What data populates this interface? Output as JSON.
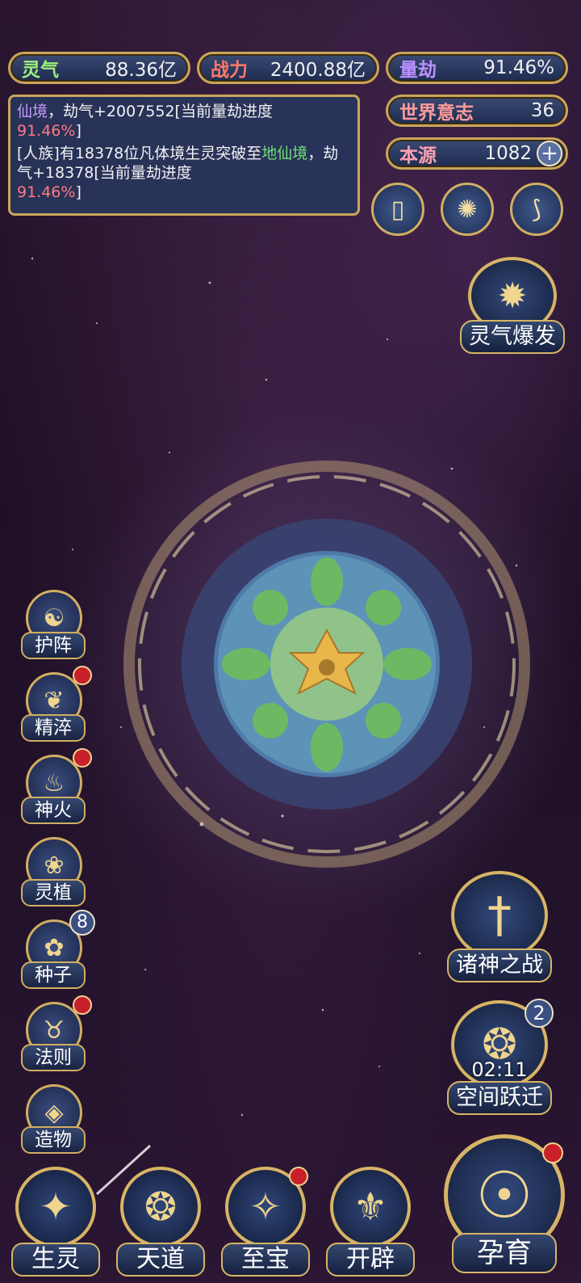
{
  "stats": {
    "lingqi_label": "灵气",
    "lingqi_value": "88.36亿",
    "zhanli_label": "战力",
    "zhanli_value": "2400.88亿",
    "liangjie_label": "量劫",
    "liangjie_value": "91.46%",
    "shijieyizhi_label": "世界意志",
    "shijieyizhi_value": "36",
    "benyuan_label": "本源",
    "benyuan_value": "1082"
  },
  "log": {
    "line1_a": "仙境",
    "line1_b": "，劫气+2007552[当前量劫进度",
    "line1_c": "91.46%",
    "line1_d": "]",
    "line2_a": "[人族]有18378位凡体境生灵突破至",
    "line2_b": "地仙境",
    "line2_c": "，劫气+18378[当前量劫进度",
    "line2_d": "91.46%",
    "line2_e": "]"
  },
  "top_icons": {
    "cards_icon": "▯",
    "vortex_icon": "✺",
    "scroll_icon": "⟆"
  },
  "burst": {
    "label": "灵气爆发"
  },
  "left_menu": [
    {
      "label": "护阵",
      "icon": "☯"
    },
    {
      "label": "精淬",
      "icon": "❦"
    },
    {
      "label": "神火",
      "icon": "♨"
    },
    {
      "label": "灵植",
      "icon": "❀"
    },
    {
      "label": "种子",
      "icon": "✿",
      "badge": "8"
    },
    {
      "label": "法则",
      "icon": "♉"
    },
    {
      "label": "造物",
      "icon": "◈"
    }
  ],
  "right_menu": {
    "war_label": "诸神之战",
    "jump_label": "空间跃迁",
    "jump_timer": "02:11",
    "jump_badge": "2"
  },
  "bottom_menu": [
    {
      "label": "生灵",
      "icon": "✦"
    },
    {
      "label": "天道",
      "icon": "❂"
    },
    {
      "label": "至宝",
      "icon": "✧"
    },
    {
      "label": "开辟",
      "icon": "⚜"
    }
  ],
  "nurture": {
    "label": "孕育",
    "icon": "☉"
  },
  "colors": {
    "gold": "#d2ae62",
    "panel": "#283460",
    "red_dot": "#c8202a"
  }
}
